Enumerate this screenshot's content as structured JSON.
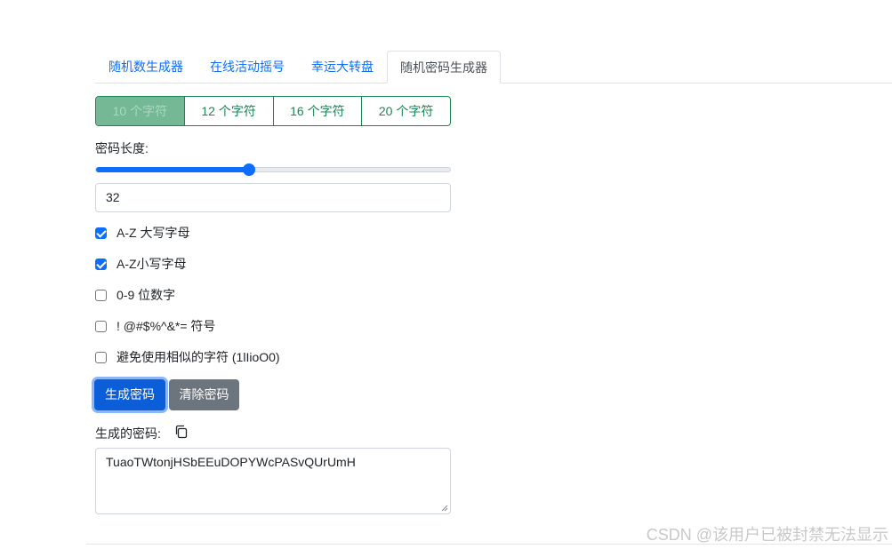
{
  "tabs": [
    {
      "label": "随机数生成器"
    },
    {
      "label": "在线活动摇号"
    },
    {
      "label": "幸运大转盘"
    },
    {
      "label": "随机密码生成器",
      "active": true
    }
  ],
  "presets": [
    "10 个字符",
    "12 个字符",
    "16 个字符",
    "20 个字符"
  ],
  "length": {
    "label": "密码长度:",
    "slider_fraction": 0.43,
    "value": "32"
  },
  "options": [
    {
      "label": "A-Z 大写字母",
      "checked": true
    },
    {
      "label": "A-Z小写字母",
      "checked": true
    },
    {
      "label": "0-9 位数字",
      "checked": false
    },
    {
      "label": "! @#$%^&*= 符号",
      "checked": false
    },
    {
      "label": "避免使用相似的字符 (1lIioO0)",
      "checked": false
    }
  ],
  "buttons": {
    "generate": "生成密码",
    "clear": "清除密码"
  },
  "output": {
    "label": "生成的密码:",
    "value": "TuaoTWtonjHSbEEuDOPYWcPASvQUrUmH",
    "copy_icon": "copy-icon"
  },
  "watermark": "CSDN @该用户已被封禁无法显示",
  "colors": {
    "primary": "#0d6efd",
    "success": "#198754",
    "secondary": "#6c757d"
  }
}
